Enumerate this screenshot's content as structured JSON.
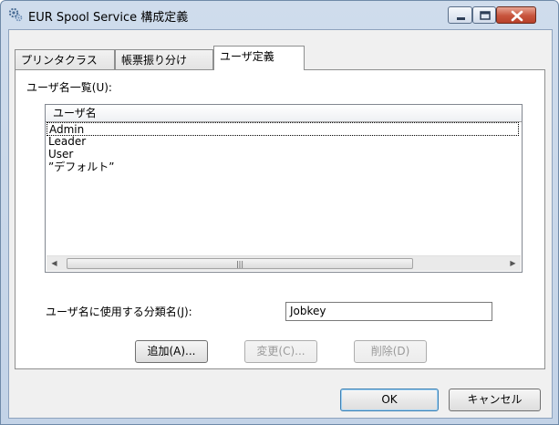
{
  "window": {
    "title": "EUR Spool Service 構成定義"
  },
  "tabs": [
    {
      "label": "プリンタクラス"
    },
    {
      "label": "帳票振り分け"
    },
    {
      "label": "ユーザ定義"
    }
  ],
  "user_list": {
    "label": "ユーザ名一覧(U):",
    "column_header": "ユーザ名",
    "items": [
      "Admin",
      "Leader",
      "User",
      "”デフォルト”"
    ]
  },
  "classification": {
    "label": "ユーザ名に使用する分類名(J):",
    "value": "Jobkey"
  },
  "actions": {
    "add_label": "追加(A)...",
    "change_label": "変更(C)...",
    "delete_label": "削除(D)"
  },
  "footer": {
    "ok_label": "OK",
    "cancel_label": "キャンセル"
  },
  "icons": {
    "app": "gear-icon",
    "minimize": "minimize-icon",
    "maximize": "maximize-icon",
    "close": "close-icon",
    "scroll_left": "scroll-left-arrow-icon",
    "scroll_right": "scroll-right-arrow-icon"
  },
  "colors": {
    "titlebar": "#c9d8ea",
    "close_button": "#c7543c",
    "dialog_background": "#f0f0f0"
  }
}
